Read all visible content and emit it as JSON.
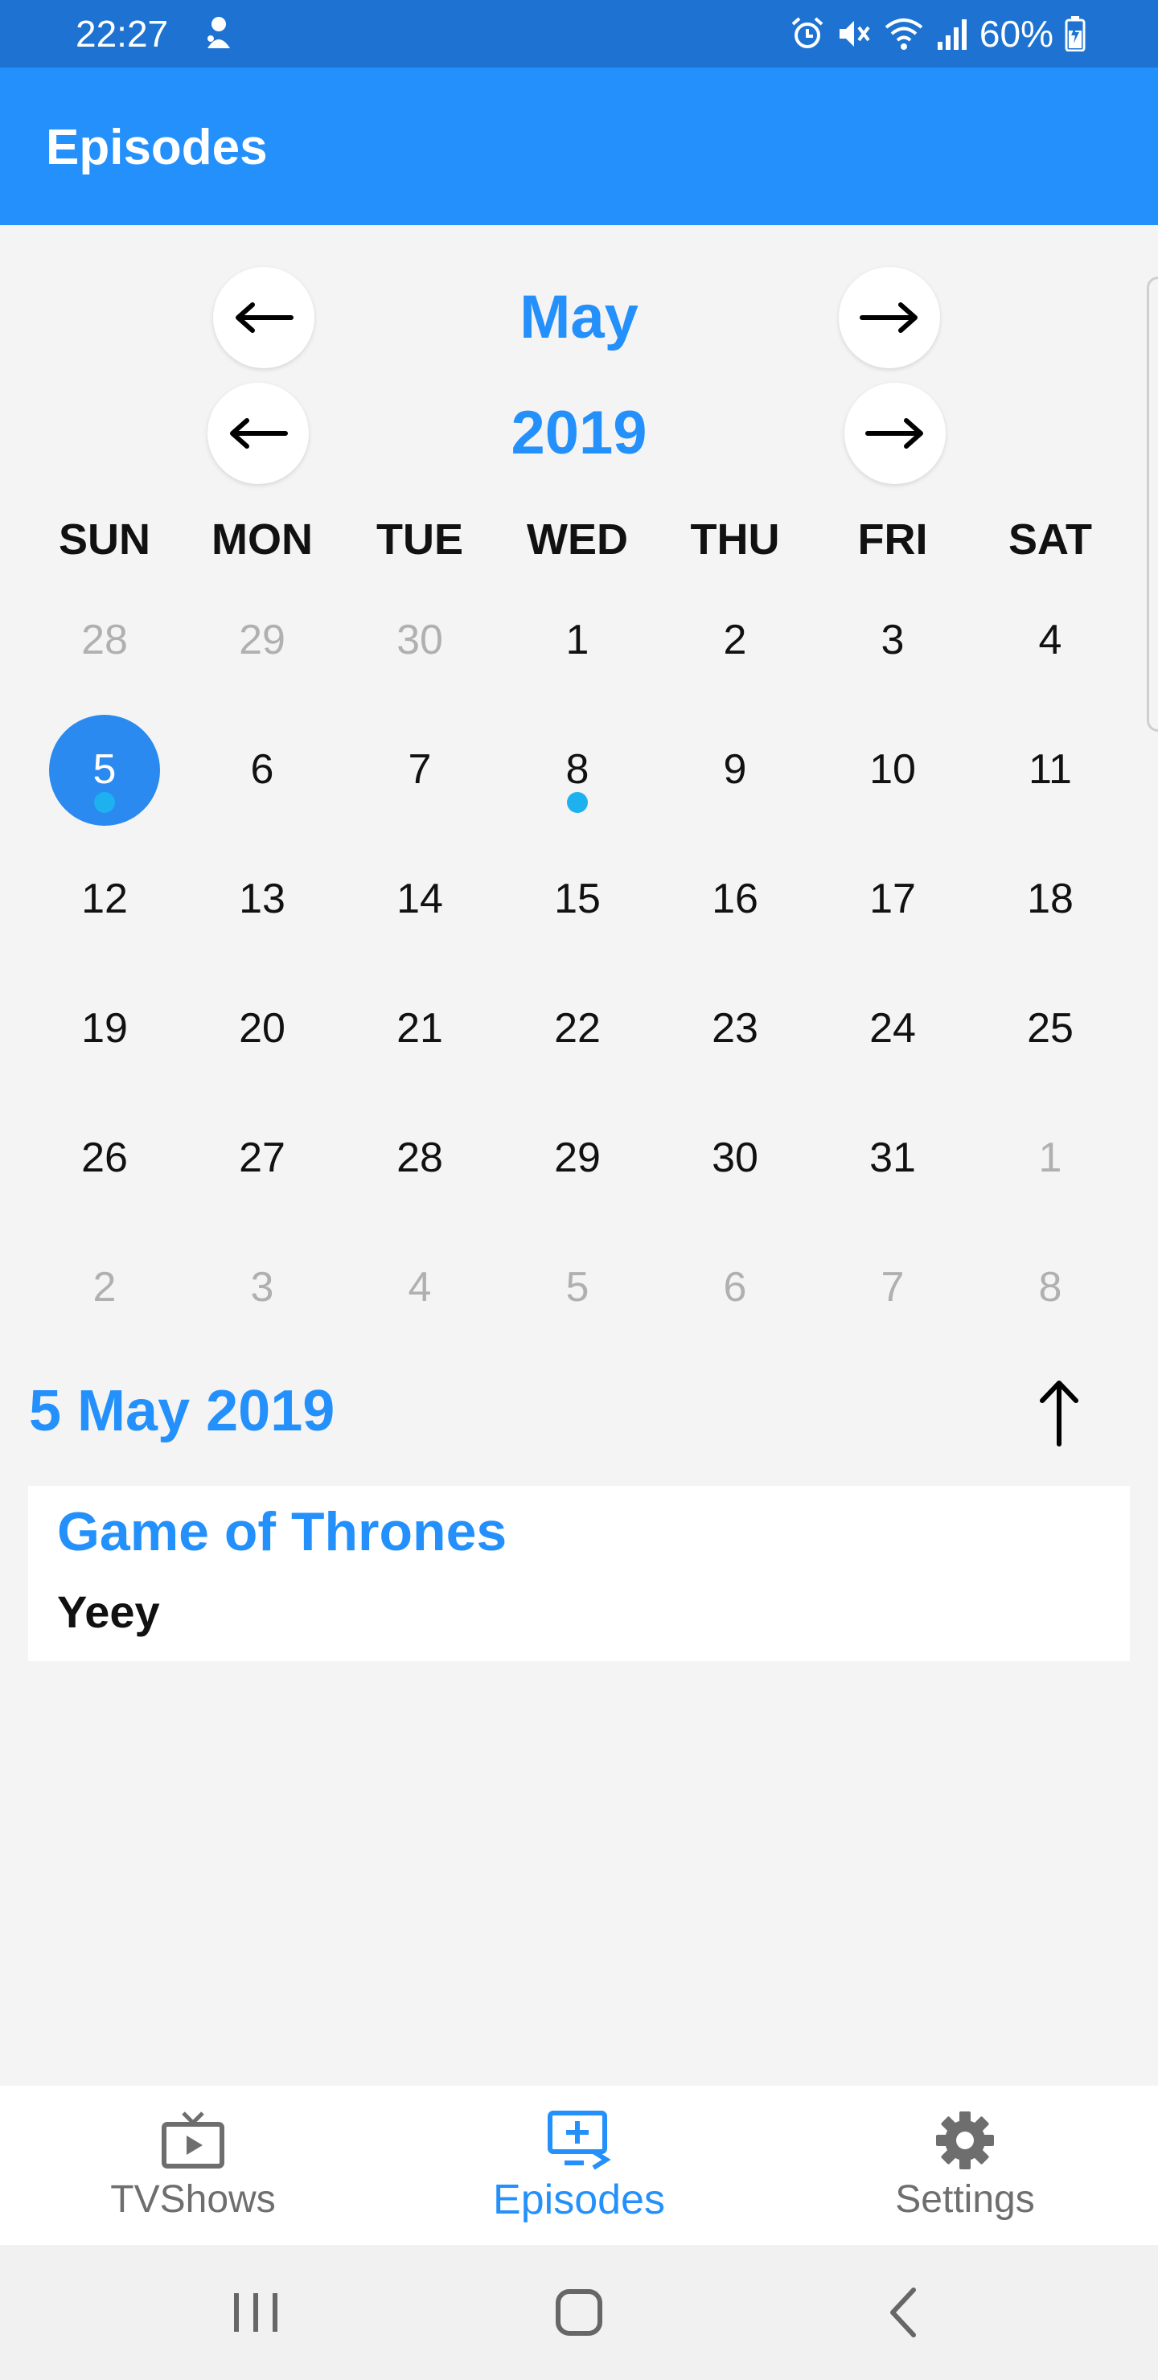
{
  "status_bar": {
    "time": "22:27",
    "battery": "60%",
    "icons": [
      "notification-icon",
      "alarm-icon",
      "mute-icon",
      "wifi-icon",
      "signal-icon",
      "battery-icon"
    ]
  },
  "app_bar": {
    "title": "Episodes"
  },
  "calendar": {
    "month": "May",
    "year": "2019",
    "weekdays": [
      "SUN",
      "MON",
      "TUE",
      "WED",
      "THU",
      "FRI",
      "SAT"
    ],
    "weeks": [
      [
        {
          "d": "28",
          "dim": true
        },
        {
          "d": "29",
          "dim": true
        },
        {
          "d": "30",
          "dim": true
        },
        {
          "d": "1"
        },
        {
          "d": "2"
        },
        {
          "d": "3"
        },
        {
          "d": "4"
        }
      ],
      [
        {
          "d": "5",
          "selected": true,
          "event": true
        },
        {
          "d": "6"
        },
        {
          "d": "7"
        },
        {
          "d": "8",
          "event": true
        },
        {
          "d": "9"
        },
        {
          "d": "10"
        },
        {
          "d": "11"
        }
      ],
      [
        {
          "d": "12"
        },
        {
          "d": "13"
        },
        {
          "d": "14"
        },
        {
          "d": "15"
        },
        {
          "d": "16"
        },
        {
          "d": "17"
        },
        {
          "d": "18"
        }
      ],
      [
        {
          "d": "19"
        },
        {
          "d": "20"
        },
        {
          "d": "21"
        },
        {
          "d": "22"
        },
        {
          "d": "23"
        },
        {
          "d": "24"
        },
        {
          "d": "25"
        }
      ],
      [
        {
          "d": "26"
        },
        {
          "d": "27"
        },
        {
          "d": "28"
        },
        {
          "d": "29"
        },
        {
          "d": "30"
        },
        {
          "d": "31"
        },
        {
          "d": "1",
          "dim": true
        }
      ],
      [
        {
          "d": "2",
          "dim": true
        },
        {
          "d": "3",
          "dim": true
        },
        {
          "d": "4",
          "dim": true
        },
        {
          "d": "5",
          "dim": true
        },
        {
          "d": "6",
          "dim": true
        },
        {
          "d": "7",
          "dim": true
        },
        {
          "d": "8",
          "dim": true
        }
      ]
    ]
  },
  "selected": {
    "date": "5 May 2019",
    "episodes": [
      {
        "show": "Game of Thrones",
        "title": "Yeey"
      }
    ]
  },
  "tabs": [
    {
      "label": "TVShows",
      "icon": "tv-icon",
      "active": false
    },
    {
      "label": "Episodes",
      "icon": "episodes-icon",
      "active": true
    },
    {
      "label": "Settings",
      "icon": "gear-icon",
      "active": false
    }
  ],
  "colors": {
    "accent": "#2490fb",
    "status_bar": "#1e73d2",
    "event_dot": "#1db1f0",
    "selected_day": "#2a8af0"
  }
}
